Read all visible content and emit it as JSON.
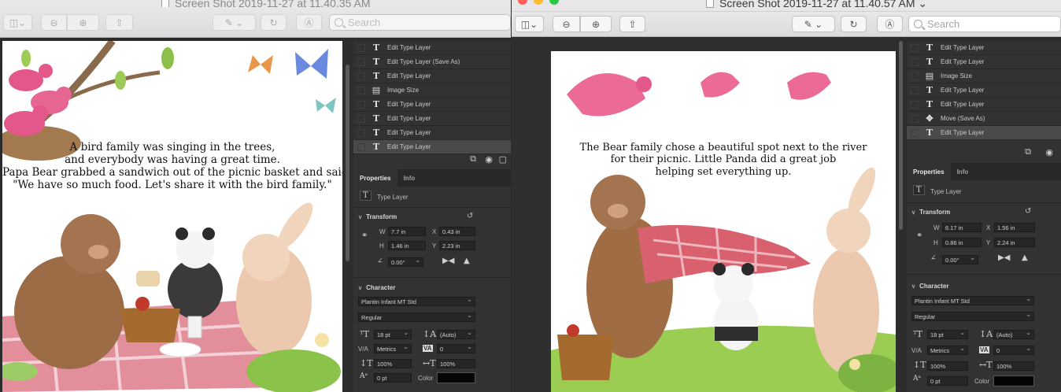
{
  "colors": {
    "traffic_close": "#fd5f57",
    "traffic_min": "#febc2e",
    "traffic_max": "#28c840",
    "ps_panel": "#323232",
    "ps_selected": "#4a4a4a"
  },
  "left_window": {
    "title": "Screen Shot 2019-11-27 at 11.40.35 AM",
    "search_placeholder": "Search",
    "story_lines": [
      "A bird family was singing in the trees,",
      "and everybody was having a great time.",
      "Papa Bear grabbed a sandwich out of the picnic basket and said:",
      "\"We have so much food. Let's share it with the bird family.\""
    ],
    "history": [
      {
        "icon": "T",
        "label": "Edit Type Layer"
      },
      {
        "icon": "T",
        "label": "Edit Type Layer (Save As)"
      },
      {
        "icon": "T",
        "label": "Edit Type Layer"
      },
      {
        "icon": "img",
        "label": "Image Size"
      },
      {
        "icon": "T",
        "label": "Edit Type Layer"
      },
      {
        "icon": "T",
        "label": "Edit Type Layer"
      },
      {
        "icon": "T",
        "label": "Edit Type Layer"
      },
      {
        "icon": "T",
        "label": "Edit Type Layer",
        "selected": true
      }
    ],
    "properties": {
      "tabs": [
        "Properties",
        "Info"
      ],
      "layer_kind": "Type Layer",
      "transform_label": "Transform",
      "w_label": "W",
      "w": "7.7 in",
      "x_label": "X",
      "x": "0.43 in",
      "h_label": "H",
      "h": "1.46 in",
      "y_label": "Y",
      "y": "2.23 in",
      "angle": "0.00°",
      "character_label": "Character",
      "font_family": "Plantin Infant MT Std",
      "font_style": "Regular",
      "size": "18 pt",
      "leading": "(Auto)",
      "kerning": "Metrics",
      "tracking": "0",
      "vscale": "100%",
      "hscale": "100%",
      "baseline": "0 pt",
      "color_label": "Color"
    }
  },
  "right_window": {
    "title": "Screen Shot 2019-11-27 at 11.40.57 AM",
    "search_placeholder": "Search",
    "story_lines": [
      "The Bear family chose a beautiful spot next to the river",
      "for their picnic. Little Panda did a great job",
      "helping set everything up."
    ],
    "history": [
      {
        "icon": "T",
        "label": "Edit Type Layer"
      },
      {
        "icon": "T",
        "label": "Edit Type Layer"
      },
      {
        "icon": "img",
        "label": "Image Size"
      },
      {
        "icon": "T",
        "label": "Edit Type Layer"
      },
      {
        "icon": "T",
        "label": "Edit Type Layer"
      },
      {
        "icon": "move",
        "label": "Move (Save As)"
      },
      {
        "icon": "T",
        "label": "Edit Type Layer",
        "selected": true
      }
    ],
    "properties": {
      "tabs": [
        "Properties",
        "Info"
      ],
      "layer_kind": "Type Layer",
      "transform_label": "Transform",
      "w_label": "W",
      "w": "6.17 in",
      "x_label": "X",
      "x": "1.56 in",
      "h_label": "H",
      "h": "0.86 in",
      "y_label": "Y",
      "y": "2.24 in",
      "angle": "0.00°",
      "character_label": "Character",
      "font_family": "Plantin Infant MT Std",
      "font_style": "Regular",
      "size": "18 pt",
      "leading": "(Auto)",
      "kerning": "Metrics",
      "tracking": "0",
      "vscale": "100%",
      "hscale": "100%",
      "baseline": "0 pt",
      "color_label": "Color"
    }
  }
}
